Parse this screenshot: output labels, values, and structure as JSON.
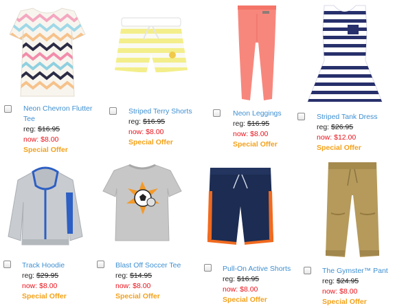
{
  "products": [
    {
      "name": "Neon Chevron Flutter Tee",
      "reg_label": "reg:",
      "reg_price": "$16.95",
      "now_label": "now:",
      "now_price": "$8.00",
      "offer": "Special Offer"
    },
    {
      "name": "Striped Terry Shorts",
      "reg_label": "reg:",
      "reg_price": "$16.95",
      "now_label": "now:",
      "now_price": "$8.00",
      "offer": "Special Offer"
    },
    {
      "name": "Neon Leggings",
      "reg_label": "reg:",
      "reg_price": "$16.95",
      "now_label": "now:",
      "now_price": "$8.00",
      "offer": "Special Offer"
    },
    {
      "name": "Striped Tank Dress",
      "reg_label": "reg:",
      "reg_price": "$26.95",
      "now_label": "now:",
      "now_price": "$12.00",
      "offer": "Special Offer"
    },
    {
      "name": "Track Hoodie",
      "reg_label": "reg:",
      "reg_price": "$29.95",
      "now_label": "now:",
      "now_price": "$8.00",
      "offer": "Special Offer"
    },
    {
      "name": "Blast Off Soccer Tee",
      "reg_label": "reg:",
      "reg_price": "$14.95",
      "now_label": "now:",
      "now_price": "$8.00",
      "offer": "Special Offer"
    },
    {
      "name": "Pull-On Active Shorts",
      "reg_label": "reg:",
      "reg_price": "$16.95",
      "now_label": "now:",
      "now_price": "$8.00",
      "offer": "Special Offer"
    },
    {
      "name": "The Gymster™ Pant",
      "reg_label": "reg:",
      "reg_price": "$24.95",
      "now_label": "now:",
      "now_price": "$8.00",
      "offer": "Special Offer"
    }
  ],
  "colors": {
    "link": "#3d8fd1",
    "sale": "#e8121b",
    "offer": "#f3a21a",
    "text": "#222222"
  }
}
